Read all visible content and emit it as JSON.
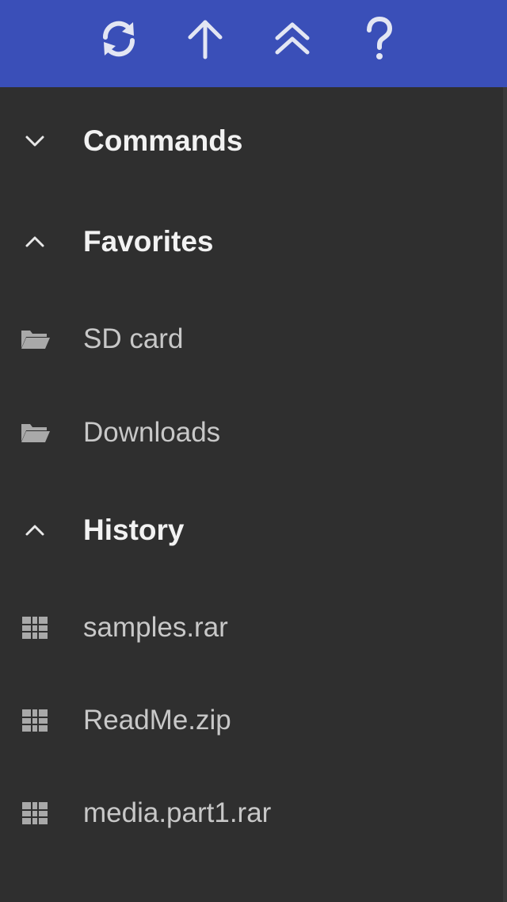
{
  "toolbar": {
    "color": "#3a4fb8",
    "buttons": [
      {
        "name": "refresh",
        "icon": "refresh-icon"
      },
      {
        "name": "up-one-level",
        "icon": "arrow-up-icon"
      },
      {
        "name": "go-to-top",
        "icon": "double-chevron-up-icon"
      },
      {
        "name": "help",
        "icon": "question-mark-icon"
      }
    ]
  },
  "sections": {
    "commands": {
      "label": "Commands",
      "expanded": false,
      "icon": "chevron-down-icon"
    },
    "favorites": {
      "label": "Favorites",
      "expanded": true,
      "icon": "chevron-up-icon",
      "items": [
        {
          "label": "SD card",
          "icon": "folder-icon"
        },
        {
          "label": "Downloads",
          "icon": "folder-icon"
        }
      ]
    },
    "history": {
      "label": "History",
      "expanded": true,
      "icon": "chevron-up-icon",
      "items": [
        {
          "label": "samples.rar",
          "icon": "archive-icon"
        },
        {
          "label": "ReadMe.zip",
          "icon": "archive-icon"
        },
        {
          "label": "media.part1.rar",
          "icon": "archive-icon"
        }
      ]
    }
  }
}
